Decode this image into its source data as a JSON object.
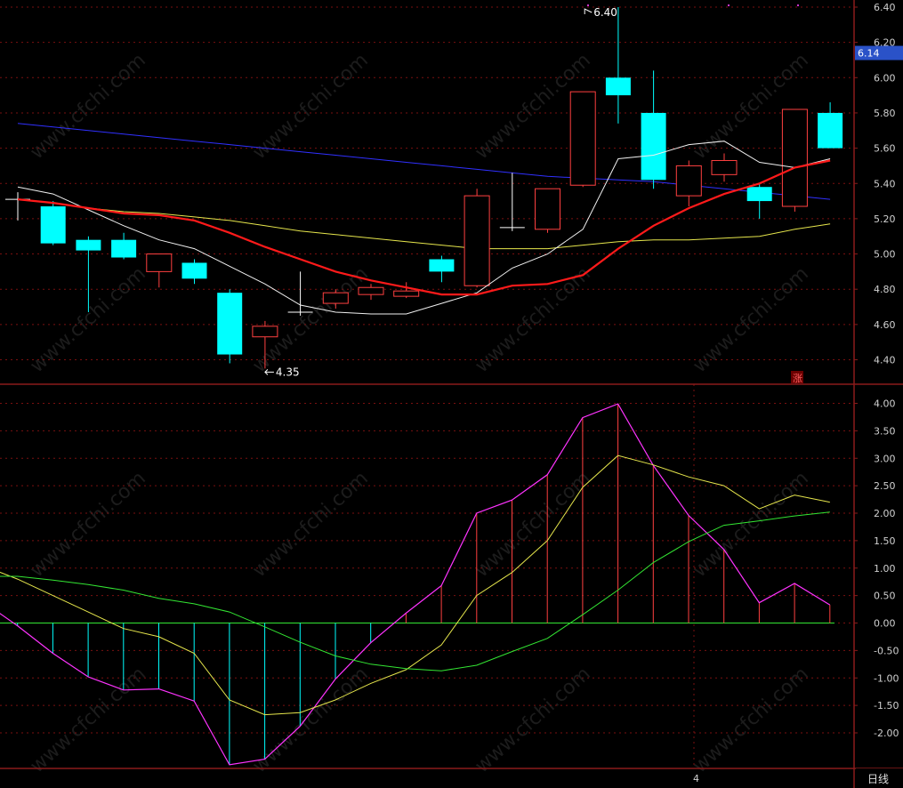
{
  "colors": {
    "background": "#000000",
    "frame": "#8b1a1a",
    "grid": "#7a1010",
    "axis_text": "#d0d0d0",
    "bull": "#ff4040",
    "bear": "#00ffff",
    "ma_white": "#f0f0f0",
    "ma_red": "#ff1a1a",
    "ma_yellow": "#e6e64c",
    "ma_blue": "#3030ff",
    "dif": "#e6e64c",
    "dea": "#33e633",
    "macd_line": "#ff33ff",
    "zero_line": "#33e633",
    "price_tag_bg": "#2a52c8"
  },
  "icons": {
    "up_flag": "涨"
  },
  "chart_data": [
    {
      "type": "candlestick",
      "panel": "price",
      "ylim": [
        4.28,
        6.45
      ],
      "yticks": [
        4.4,
        4.6,
        4.8,
        5.0,
        5.2,
        5.4,
        5.6,
        5.8,
        6.0,
        6.2,
        6.4
      ],
      "ytick_labels": [
        "4.40",
        "4.60",
        "4.80",
        "5.00",
        "5.20",
        "5.40",
        "5.60",
        "5.80",
        "6.00",
        "6.20",
        "6.40"
      ],
      "current_price_label": "6.14",
      "current_price": 6.14,
      "max_annotation": {
        "index": 17,
        "value": 6.4,
        "label": "6.40"
      },
      "min_annotation": {
        "index": 7,
        "value": 4.35,
        "label": "4.35"
      },
      "up_flag_label": "涨",
      "candles": [
        {
          "o": 5.31,
          "h": 5.35,
          "l": 5.19,
          "c": 5.31
        },
        {
          "o": 5.27,
          "h": 5.3,
          "l": 5.05,
          "c": 5.06
        },
        {
          "o": 5.08,
          "h": 5.1,
          "l": 4.67,
          "c": 5.02
        },
        {
          "o": 5.08,
          "h": 5.12,
          "l": 4.97,
          "c": 4.98
        },
        {
          "o": 4.9,
          "h": 5.0,
          "l": 4.81,
          "c": 5.0
        },
        {
          "o": 4.95,
          "h": 4.97,
          "l": 4.83,
          "c": 4.86
        },
        {
          "o": 4.78,
          "h": 4.8,
          "l": 4.38,
          "c": 4.43
        },
        {
          "o": 4.53,
          "h": 4.62,
          "l": 4.35,
          "c": 4.59
        },
        {
          "o": 4.67,
          "h": 4.9,
          "l": 4.65,
          "c": 4.67
        },
        {
          "o": 4.72,
          "h": 4.8,
          "l": 4.69,
          "c": 4.78
        },
        {
          "o": 4.77,
          "h": 4.83,
          "l": 4.74,
          "c": 4.81
        },
        {
          "o": 4.76,
          "h": 4.84,
          "l": 4.75,
          "c": 4.79
        },
        {
          "o": 4.97,
          "h": 4.99,
          "l": 4.84,
          "c": 4.9
        },
        {
          "o": 4.82,
          "h": 5.37,
          "l": 4.81,
          "c": 5.33
        },
        {
          "o": 5.15,
          "h": 5.46,
          "l": 5.13,
          "c": 5.15
        },
        {
          "o": 5.14,
          "h": 5.37,
          "l": 5.12,
          "c": 5.37
        },
        {
          "o": 5.39,
          "h": 5.92,
          "l": 5.38,
          "c": 5.92
        },
        {
          "o": 6.0,
          "h": 6.4,
          "l": 5.74,
          "c": 5.9
        },
        {
          "o": 5.8,
          "h": 6.04,
          "l": 5.37,
          "c": 5.42
        },
        {
          "o": 5.33,
          "h": 5.53,
          "l": 5.27,
          "c": 5.5
        },
        {
          "o": 5.45,
          "h": 5.57,
          "l": 5.41,
          "c": 5.53
        },
        {
          "o": 5.38,
          "h": 5.4,
          "l": 5.2,
          "c": 5.3
        },
        {
          "o": 5.27,
          "h": 5.82,
          "l": 5.24,
          "c": 5.82
        },
        {
          "o": 5.8,
          "h": 5.86,
          "l": 5.6,
          "c": 5.6
        }
      ],
      "series": [
        {
          "color": "ma_white",
          "values": [
            5.38,
            5.34,
            5.25,
            5.16,
            5.08,
            5.03,
            4.93,
            4.83,
            4.71,
            4.67,
            4.66,
            4.66,
            4.72,
            4.78,
            4.92,
            5.0,
            5.14,
            5.54,
            5.56,
            5.62,
            5.64,
            5.52,
            5.49,
            5.54
          ]
        },
        {
          "color": "ma_red",
          "values": [
            5.31,
            5.29,
            5.26,
            5.23,
            5.22,
            5.19,
            5.12,
            5.04,
            4.97,
            4.9,
            4.85,
            4.81,
            4.77,
            4.77,
            4.82,
            4.83,
            4.88,
            5.03,
            5.16,
            5.26,
            5.34,
            5.4,
            5.49,
            5.53
          ]
        },
        {
          "color": "ma_yellow",
          "values": [
            5.31,
            5.29,
            5.26,
            5.24,
            5.23,
            5.21,
            5.19,
            5.16,
            5.13,
            5.11,
            5.09,
            5.07,
            5.05,
            5.03,
            5.03,
            5.03,
            5.05,
            5.07,
            5.08,
            5.08,
            5.09,
            5.1,
            5.14,
            5.17
          ]
        },
        {
          "color": "ma_blue",
          "values": [
            5.74,
            5.72,
            5.7,
            5.68,
            5.66,
            5.64,
            5.62,
            5.6,
            5.58,
            5.56,
            5.54,
            5.52,
            5.5,
            5.48,
            5.46,
            5.44,
            5.43,
            5.42,
            5.41,
            5.39,
            5.37,
            5.35,
            5.33,
            5.31
          ]
        }
      ]
    },
    {
      "type": "macd",
      "panel": "indicator",
      "ylim": [
        -2.65,
        4.15
      ],
      "yticks": [
        4.0,
        3.5,
        3.0,
        2.5,
        2.0,
        1.5,
        1.0,
        0.5,
        0.0,
        -0.5,
        -1.0,
        -1.5,
        -2.0
      ],
      "ytick_labels": [
        "4.00",
        "3.50",
        "3.00",
        "2.50",
        "2.00",
        "1.50",
        "1.00",
        "0.50",
        "0.00",
        "-0.50",
        "-1.00",
        "-1.50",
        "-2.00"
      ],
      "histogram": [
        0.4,
        -0.05,
        -0.55,
        -0.98,
        -1.22,
        -1.2,
        -1.42,
        -2.58,
        -2.48,
        -1.88,
        -1.02,
        -0.36,
        0.18,
        0.68,
        2.0,
        2.24,
        2.7,
        3.74,
        3.99,
        2.87,
        1.96,
        1.34,
        0.37,
        0.72,
        0.33
      ],
      "series": [
        {
          "color": "dif",
          "values": [
            1.05,
            0.8,
            0.5,
            0.2,
            -0.1,
            -0.25,
            -0.55,
            -1.4,
            -1.67,
            -1.63,
            -1.4,
            -1.1,
            -0.85,
            -0.4,
            0.5,
            0.92,
            1.5,
            2.47,
            3.05,
            2.88,
            2.66,
            2.5,
            2.08,
            2.33,
            2.2
          ]
        },
        {
          "color": "dea",
          "values": [
            0.85,
            0.85,
            0.78,
            0.7,
            0.6,
            0.45,
            0.35,
            0.2,
            -0.07,
            -0.35,
            -0.6,
            -0.75,
            -0.83,
            -0.87,
            -0.77,
            -0.52,
            -0.28,
            0.15,
            0.6,
            1.1,
            1.48,
            1.78,
            1.86,
            1.95,
            2.02
          ]
        }
      ]
    }
  ],
  "footer": {
    "date_marker": "4",
    "period_label": "日线"
  },
  "watermark": "www.cfchi.com"
}
